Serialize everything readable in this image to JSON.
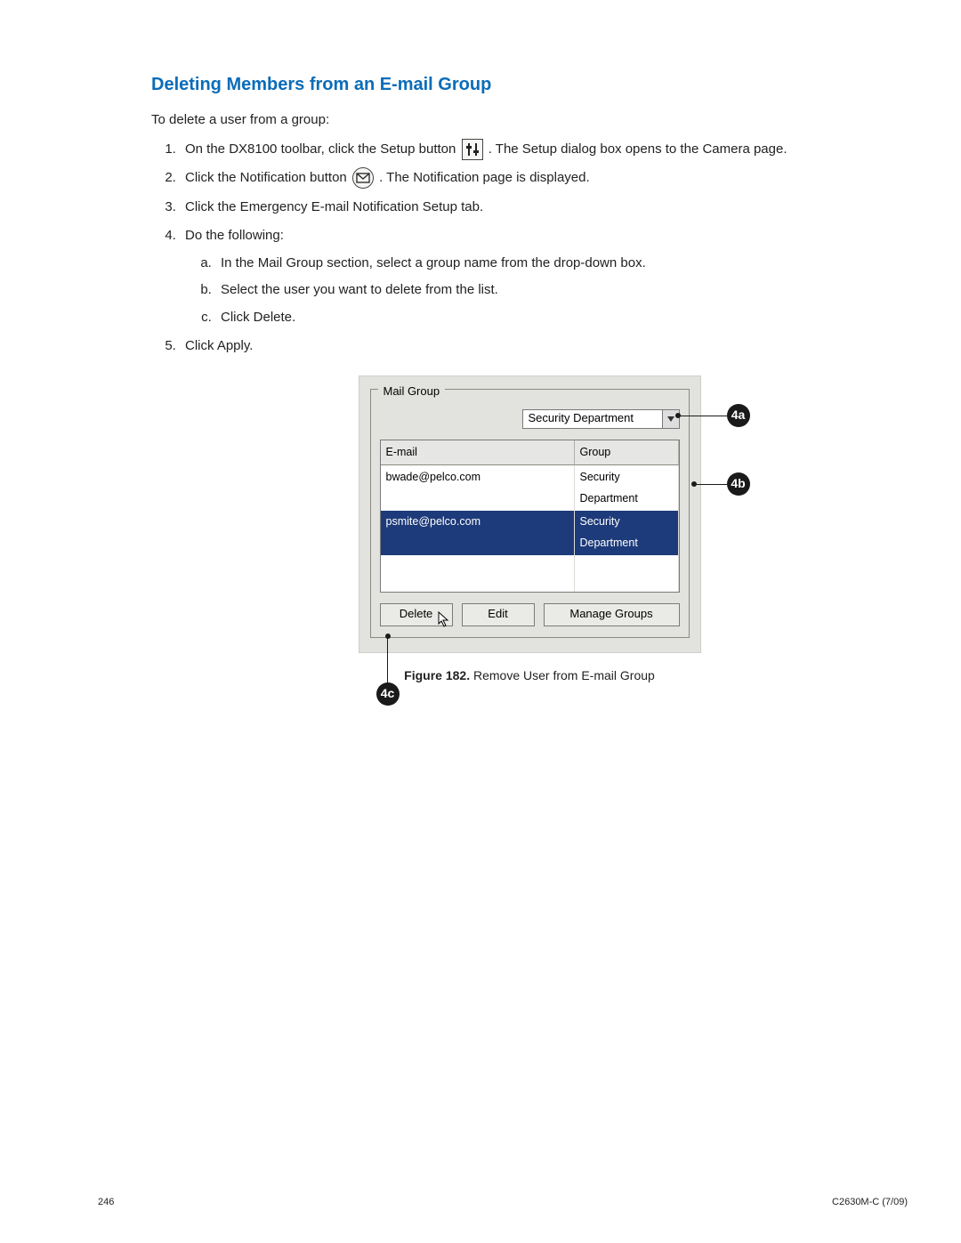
{
  "heading": "Deleting Members from an E-mail Group",
  "intro": "To delete a user from a group:",
  "steps": {
    "s1_a": "On the DX8100 toolbar, click the Setup button ",
    "s1_b": ". The Setup dialog box opens to the Camera page.",
    "s2_a": "Click the Notification button ",
    "s2_b": ". The Notification page is displayed.",
    "s3": "Click the Emergency E-mail Notification Setup tab.",
    "s4": "Do the following:",
    "s4a": "In the Mail Group section, select a group name from the drop-down box.",
    "s4b": "Select the user you want to delete from the list.",
    "s4c": "Click Delete.",
    "s5": "Click Apply."
  },
  "panel": {
    "legend": "Mail Group",
    "dropdown": "Security Department",
    "headers": {
      "email": "E-mail",
      "group": "Group"
    },
    "rows": [
      {
        "email": "bwade@pelco.com",
        "group": "Security Department",
        "selected": false
      },
      {
        "email": "psmite@pelco.com",
        "group": "Security Department",
        "selected": true
      }
    ],
    "buttons": {
      "delete": "Delete",
      "edit": "Edit",
      "manage": "Manage Groups"
    }
  },
  "callouts": {
    "a": "4a",
    "b": "4b",
    "c": "4c"
  },
  "caption_label": "Figure 182.",
  "caption_text": "  Remove User from E-mail Group",
  "footer": {
    "left": "246",
    "right": "C2630M-C (7/09)"
  }
}
